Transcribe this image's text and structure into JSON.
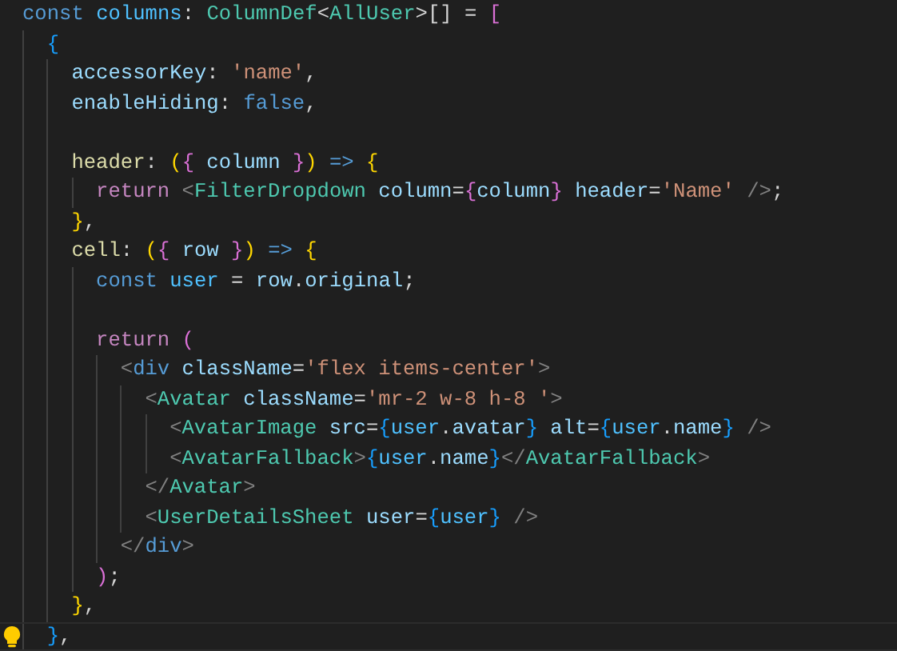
{
  "editor": {
    "lines": [
      {
        "current": false,
        "tokens": [
          {
            "kind": "storage",
            "text": "const"
          },
          {
            "kind": "constant",
            "text": " columns"
          },
          {
            "kind": "punct",
            "text": ": "
          },
          {
            "kind": "type",
            "text": "ColumnDef"
          },
          {
            "kind": "punct",
            "text": "<"
          },
          {
            "kind": "type",
            "text": "AllUser"
          },
          {
            "kind": "punct",
            "text": ">[] = "
          },
          {
            "kind": "bracket2",
            "text": "["
          }
        ]
      },
      {
        "current": false,
        "tokens": [
          {
            "kind": "bracket3",
            "text": "  {"
          }
        ]
      },
      {
        "current": false,
        "tokens": [
          {
            "kind": "variable",
            "text": "    accessorKey"
          },
          {
            "kind": "punct",
            "text": ": "
          },
          {
            "kind": "string",
            "text": "'name'"
          },
          {
            "kind": "punct",
            "text": ","
          }
        ]
      },
      {
        "current": false,
        "tokens": [
          {
            "kind": "variable",
            "text": "    enableHiding"
          },
          {
            "kind": "punct",
            "text": ": "
          },
          {
            "kind": "storage",
            "text": "false"
          },
          {
            "kind": "punct",
            "text": ","
          }
        ]
      },
      {
        "current": false
      },
      {
        "current": false,
        "tokens": [
          {
            "kind": "function",
            "text": "    header"
          },
          {
            "kind": "punct",
            "text": ": "
          },
          {
            "kind": "bracket1",
            "text": "("
          },
          {
            "kind": "bracket2",
            "text": "{"
          },
          {
            "kind": "variable",
            "text": " column "
          },
          {
            "kind": "bracket2",
            "text": "}"
          },
          {
            "kind": "bracket1",
            "text": ")"
          },
          {
            "kind": "storage",
            "text": " => "
          },
          {
            "kind": "bracket1",
            "text": "{"
          }
        ]
      },
      {
        "current": false,
        "tokens": [
          {
            "kind": "control",
            "text": "      return"
          },
          {
            "kind": "tag",
            "text": " <"
          },
          {
            "kind": "component",
            "text": "FilterDropdown"
          },
          {
            "kind": "variable",
            "text": " column"
          },
          {
            "kind": "punct",
            "text": "="
          },
          {
            "kind": "bracket2",
            "text": "{"
          },
          {
            "kind": "variable",
            "text": "column"
          },
          {
            "kind": "bracket2",
            "text": "}"
          },
          {
            "kind": "variable",
            "text": " header"
          },
          {
            "kind": "punct",
            "text": "="
          },
          {
            "kind": "string",
            "text": "'Name'"
          },
          {
            "kind": "tag",
            "text": " />"
          },
          {
            "kind": "punct",
            "text": ";"
          }
        ]
      },
      {
        "current": false,
        "tokens": [
          {
            "kind": "bracket1",
            "text": "    }"
          },
          {
            "kind": "punct",
            "text": ","
          }
        ]
      },
      {
        "current": false,
        "tokens": [
          {
            "kind": "function",
            "text": "    cell"
          },
          {
            "kind": "punct",
            "text": ": "
          },
          {
            "kind": "bracket1",
            "text": "("
          },
          {
            "kind": "bracket2",
            "text": "{"
          },
          {
            "kind": "variable",
            "text": " row "
          },
          {
            "kind": "bracket2",
            "text": "}"
          },
          {
            "kind": "bracket1",
            "text": ")"
          },
          {
            "kind": "storage",
            "text": " => "
          },
          {
            "kind": "bracket1",
            "text": "{"
          }
        ]
      },
      {
        "current": false,
        "tokens": [
          {
            "kind": "storage",
            "text": "      const"
          },
          {
            "kind": "constant",
            "text": " user"
          },
          {
            "kind": "punct",
            "text": " = "
          },
          {
            "kind": "variable",
            "text": "row"
          },
          {
            "kind": "punct",
            "text": "."
          },
          {
            "kind": "variable",
            "text": "original"
          },
          {
            "kind": "punct",
            "text": ";"
          }
        ]
      },
      {
        "current": false
      },
      {
        "current": false,
        "tokens": [
          {
            "kind": "control",
            "text": "      return"
          },
          {
            "kind": "bracket2",
            "text": " ("
          }
        ]
      },
      {
        "current": false,
        "tokens": [
          {
            "kind": "tag",
            "text": "        <"
          },
          {
            "kind": "htmltag",
            "text": "div"
          },
          {
            "kind": "variable",
            "text": " className"
          },
          {
            "kind": "punct",
            "text": "="
          },
          {
            "kind": "string",
            "text": "'flex items-center'"
          },
          {
            "kind": "tag",
            "text": ">"
          }
        ]
      },
      {
        "current": false,
        "tokens": [
          {
            "kind": "tag",
            "text": "          <"
          },
          {
            "kind": "component",
            "text": "Avatar"
          },
          {
            "kind": "variable",
            "text": " className"
          },
          {
            "kind": "punct",
            "text": "="
          },
          {
            "kind": "string",
            "text": "'mr-2 w-8 h-8 '"
          },
          {
            "kind": "tag",
            "text": ">"
          }
        ]
      },
      {
        "current": false,
        "tokens": [
          {
            "kind": "tag",
            "text": "            <"
          },
          {
            "kind": "component",
            "text": "AvatarImage"
          },
          {
            "kind": "variable",
            "text": " src"
          },
          {
            "kind": "punct",
            "text": "="
          },
          {
            "kind": "bracket3",
            "text": "{"
          },
          {
            "kind": "constant",
            "text": "user"
          },
          {
            "kind": "punct",
            "text": "."
          },
          {
            "kind": "variable",
            "text": "avatar"
          },
          {
            "kind": "bracket3",
            "text": "}"
          },
          {
            "kind": "variable",
            "text": " alt"
          },
          {
            "kind": "punct",
            "text": "="
          },
          {
            "kind": "bracket3",
            "text": "{"
          },
          {
            "kind": "constant",
            "text": "user"
          },
          {
            "kind": "punct",
            "text": "."
          },
          {
            "kind": "variable",
            "text": "name"
          },
          {
            "kind": "bracket3",
            "text": "}"
          },
          {
            "kind": "tag",
            "text": " />"
          }
        ]
      },
      {
        "current": false,
        "tokens": [
          {
            "kind": "tag",
            "text": "            <"
          },
          {
            "kind": "component",
            "text": "AvatarFallback"
          },
          {
            "kind": "tag",
            "text": ">"
          },
          {
            "kind": "bracket3",
            "text": "{"
          },
          {
            "kind": "constant",
            "text": "user"
          },
          {
            "kind": "punct",
            "text": "."
          },
          {
            "kind": "variable",
            "text": "name"
          },
          {
            "kind": "bracket3",
            "text": "}"
          },
          {
            "kind": "tag",
            "text": "</"
          },
          {
            "kind": "component",
            "text": "AvatarFallback"
          },
          {
            "kind": "tag",
            "text": ">"
          }
        ]
      },
      {
        "current": false,
        "tokens": [
          {
            "kind": "tag",
            "text": "          </"
          },
          {
            "kind": "component",
            "text": "Avatar"
          },
          {
            "kind": "tag",
            "text": ">"
          }
        ]
      },
      {
        "current": false,
        "tokens": [
          {
            "kind": "tag",
            "text": "          <"
          },
          {
            "kind": "component",
            "text": "UserDetailsSheet"
          },
          {
            "kind": "variable",
            "text": " user"
          },
          {
            "kind": "punct",
            "text": "="
          },
          {
            "kind": "bracket3",
            "text": "{"
          },
          {
            "kind": "constant",
            "text": "user"
          },
          {
            "kind": "bracket3",
            "text": "}"
          },
          {
            "kind": "tag",
            "text": " />"
          }
        ]
      },
      {
        "current": false,
        "tokens": [
          {
            "kind": "tag",
            "text": "        </"
          },
          {
            "kind": "htmltag",
            "text": "div"
          },
          {
            "kind": "tag",
            "text": ">"
          }
        ]
      },
      {
        "current": false,
        "tokens": [
          {
            "kind": "bracket2",
            "text": "      )"
          },
          {
            "kind": "punct",
            "text": ";"
          }
        ]
      },
      {
        "current": false,
        "tokens": [
          {
            "kind": "bracket1",
            "text": "    }"
          },
          {
            "kind": "punct",
            "text": ","
          }
        ]
      },
      {
        "current": true,
        "tokens": [
          {
            "kind": "bracket3",
            "text": "  }"
          },
          {
            "kind": "punct",
            "text": ","
          }
        ]
      }
    ]
  }
}
